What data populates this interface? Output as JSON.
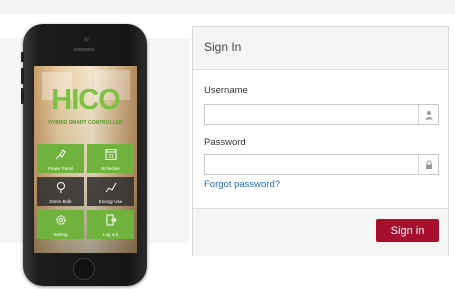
{
  "card": {
    "title": "Sign In",
    "username_label": "Username",
    "username_value": "",
    "password_label": "Password",
    "password_value": "",
    "forgot_link": "Forgot password?",
    "signin_button": "Sign in"
  },
  "phone_app": {
    "logo": "HICO",
    "subtitle": "HYBRID SMART CONTROLLER",
    "tiles": [
      {
        "label": "Power Panel",
        "icon": "plug-icon"
      },
      {
        "label": "Schedule",
        "icon": "calendar-icon",
        "calendar_day": "31"
      },
      {
        "label": "Dimm Bulb",
        "icon": "bulb-icon"
      },
      {
        "label": "Energy Use",
        "icon": "chart-line-icon"
      },
      {
        "label": "Setting",
        "icon": "gear-icon"
      },
      {
        "label": "Log out",
        "icon": "logout-icon"
      }
    ]
  },
  "colors": {
    "accent": "#a6102c",
    "link": "#2a6db3",
    "brand_green": "#7cc242",
    "tile_green": "#6fb33d"
  }
}
